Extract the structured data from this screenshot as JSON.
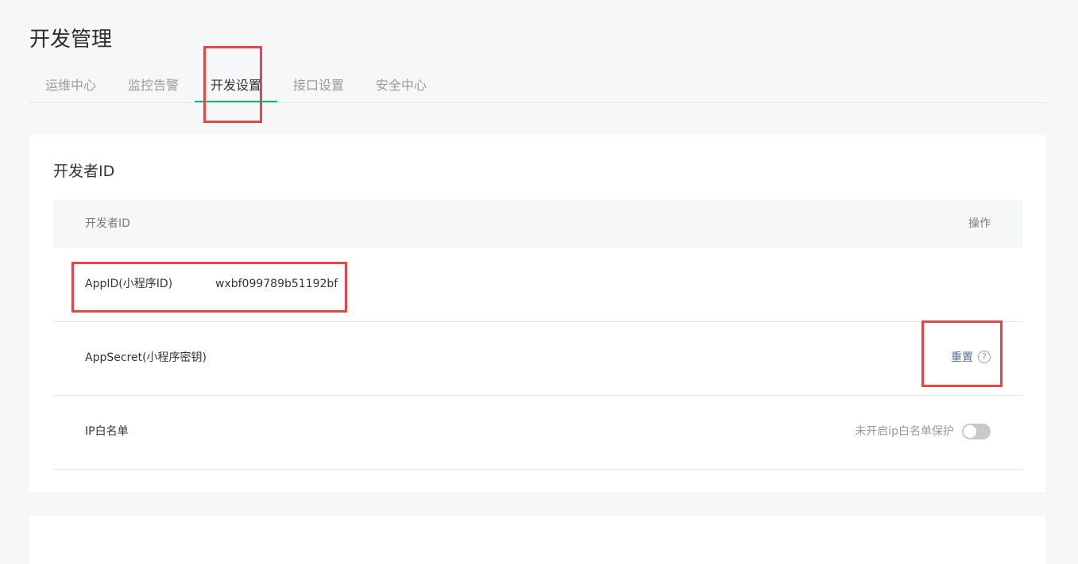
{
  "page": {
    "title": "开发管理"
  },
  "tabs": [
    {
      "label": "运维中心",
      "active": false
    },
    {
      "label": "监控告警",
      "active": false
    },
    {
      "label": "开发设置",
      "active": true
    },
    {
      "label": "接口设置",
      "active": false
    },
    {
      "label": "安全中心",
      "active": false
    }
  ],
  "developer_section": {
    "title": "开发者ID",
    "header": {
      "col1": "开发者ID",
      "col2": "操作"
    },
    "rows": {
      "appid": {
        "label": "AppID(小程序ID)",
        "value": "wxbf099789b51192bf"
      },
      "secret": {
        "label": "AppSecret(小程序密钥)",
        "action": "重置",
        "help": "?"
      },
      "ip_whitelist": {
        "label": "IP白名单",
        "status": "未开启ip白名单保护",
        "enabled": false
      }
    }
  },
  "colors": {
    "accent": "#07c160",
    "link": "#576b95",
    "highlight": "#e2474a",
    "background": "#f6f7f8"
  }
}
